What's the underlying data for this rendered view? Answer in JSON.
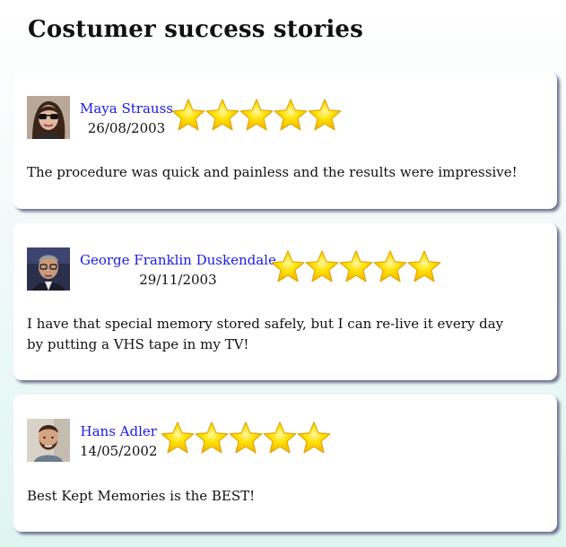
{
  "page": {
    "title": "Costumer success stories"
  },
  "reviews": [
    {
      "name": "Maya Strauss",
      "date": "26/08/2003",
      "rating": 5,
      "text": "The procedure was quick and painless and the results were impressive!",
      "avatar_icon": "woman-with-sunglasses-avatar"
    },
    {
      "name": "George Franklin Duskendale",
      "date": "29/11/2003",
      "rating": 5,
      "text": "I have that special memory stored safely, but I can re-live it every day by putting a VHS tape in my TV!",
      "avatar_icon": "man-with-glasses-avatar"
    },
    {
      "name": "Hans Adler",
      "date": "14/05/2002",
      "rating": 5,
      "text": "Best Kept Memories is the BEST!",
      "avatar_icon": "bearded-man-avatar"
    }
  ],
  "colors": {
    "link": "#1a1ae6",
    "star_fill": "#ffd400",
    "star_edge": "#e6a800"
  }
}
